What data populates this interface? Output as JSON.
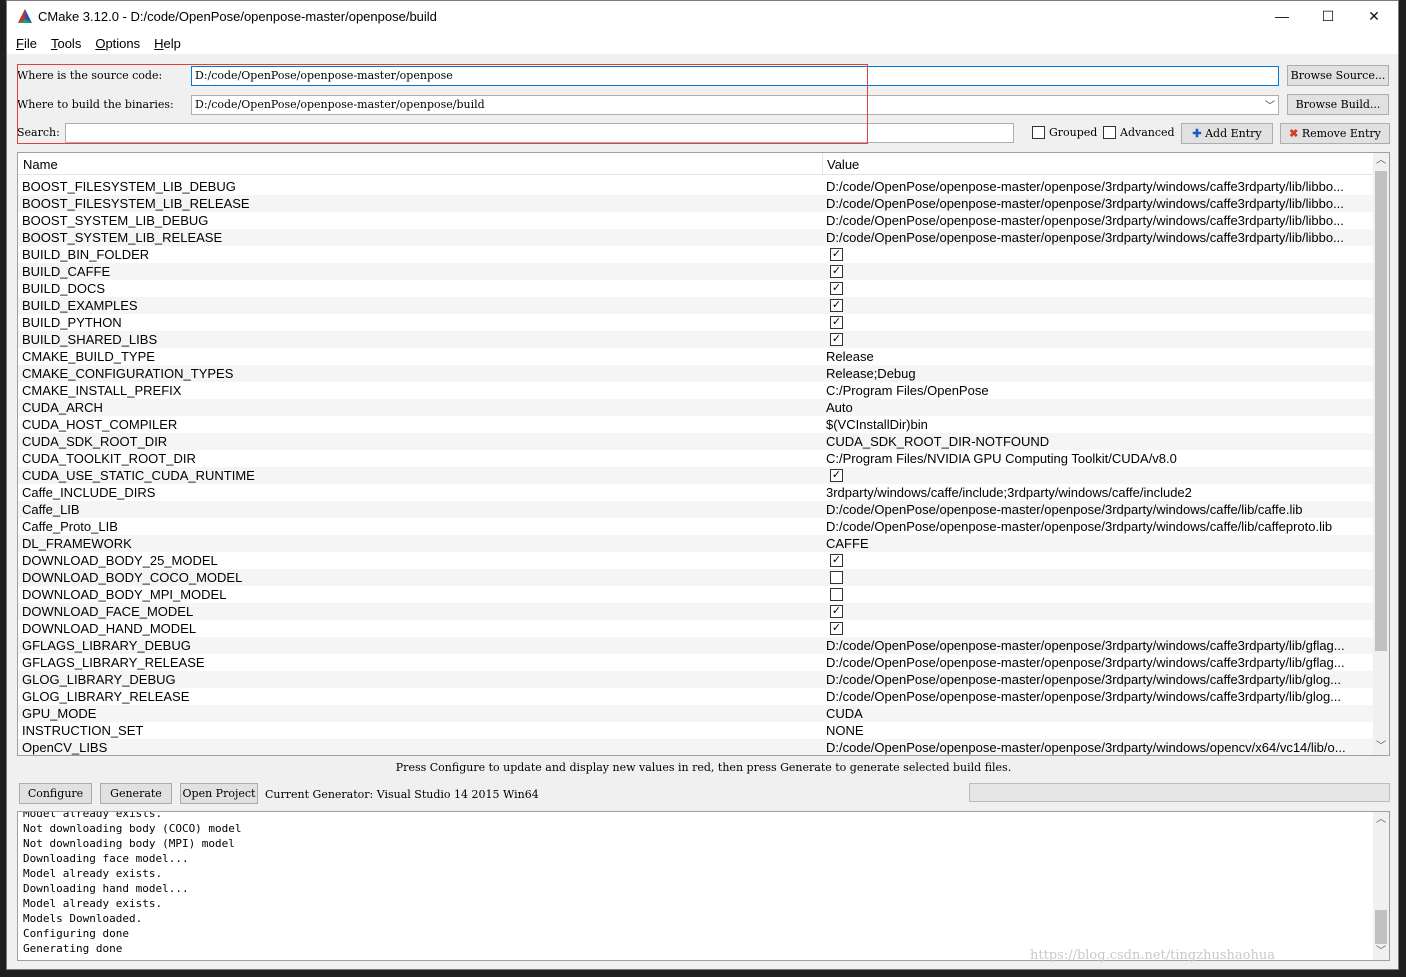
{
  "window": {
    "title": "CMake 3.12.0 - D:/code/OpenPose/openpose-master/openpose/build",
    "minimize_glyph": "—",
    "maximize_glyph": "☐",
    "close_glyph": "✕"
  },
  "menu": [
    {
      "key": "F",
      "rest": "ile"
    },
    {
      "key": "T",
      "rest": "ools"
    },
    {
      "key": "O",
      "rest": "ptions"
    },
    {
      "key": "H",
      "rest": "elp"
    }
  ],
  "paths": {
    "source_label": "Where is the source code:",
    "source_value": "D:/code/OpenPose/openpose-master/openpose",
    "browse_source": "Browse Source...",
    "build_label": "Where to build the binaries:",
    "build_value": "D:/code/OpenPose/openpose-master/openpose/build",
    "browse_build": "Browse Build...",
    "search_label": "Search:",
    "search_value": ""
  },
  "toolbar": {
    "grouped": "Grouped",
    "advanced": "Advanced",
    "add_entry": "Add Entry",
    "remove_entry": "Remove Entry"
  },
  "table": {
    "col_name": "Name",
    "col_value": "Value",
    "rows": [
      {
        "name": "BOOST_FILESYSTEM_LIB_DEBUG",
        "type": "text",
        "value": "D:/code/OpenPose/openpose-master/openpose/3rdparty/windows/caffe3rdparty/lib/libbo..."
      },
      {
        "name": "BOOST_FILESYSTEM_LIB_RELEASE",
        "type": "text",
        "value": "D:/code/OpenPose/openpose-master/openpose/3rdparty/windows/caffe3rdparty/lib/libbo..."
      },
      {
        "name": "BOOST_SYSTEM_LIB_DEBUG",
        "type": "text",
        "value": "D:/code/OpenPose/openpose-master/openpose/3rdparty/windows/caffe3rdparty/lib/libbo..."
      },
      {
        "name": "BOOST_SYSTEM_LIB_RELEASE",
        "type": "text",
        "value": "D:/code/OpenPose/openpose-master/openpose/3rdparty/windows/caffe3rdparty/lib/libbo..."
      },
      {
        "name": "BUILD_BIN_FOLDER",
        "type": "bool",
        "checked": true
      },
      {
        "name": "BUILD_CAFFE",
        "type": "bool",
        "checked": true
      },
      {
        "name": "BUILD_DOCS",
        "type": "bool",
        "checked": true
      },
      {
        "name": "BUILD_EXAMPLES",
        "type": "bool",
        "checked": true
      },
      {
        "name": "BUILD_PYTHON",
        "type": "bool",
        "checked": true
      },
      {
        "name": "BUILD_SHARED_LIBS",
        "type": "bool",
        "checked": true
      },
      {
        "name": "CMAKE_BUILD_TYPE",
        "type": "text",
        "value": "Release"
      },
      {
        "name": "CMAKE_CONFIGURATION_TYPES",
        "type": "text",
        "value": "Release;Debug"
      },
      {
        "name": "CMAKE_INSTALL_PREFIX",
        "type": "text",
        "value": "C:/Program Files/OpenPose"
      },
      {
        "name": "CUDA_ARCH",
        "type": "text",
        "value": "Auto"
      },
      {
        "name": "CUDA_HOST_COMPILER",
        "type": "text",
        "value": "$(VCInstallDir)bin"
      },
      {
        "name": "CUDA_SDK_ROOT_DIR",
        "type": "text",
        "value": "CUDA_SDK_ROOT_DIR-NOTFOUND"
      },
      {
        "name": "CUDA_TOOLKIT_ROOT_DIR",
        "type": "text",
        "value": "C:/Program Files/NVIDIA GPU Computing Toolkit/CUDA/v8.0"
      },
      {
        "name": "CUDA_USE_STATIC_CUDA_RUNTIME",
        "type": "bool",
        "checked": true
      },
      {
        "name": "Caffe_INCLUDE_DIRS",
        "type": "text",
        "value": "3rdparty/windows/caffe/include;3rdparty/windows/caffe/include2"
      },
      {
        "name": "Caffe_LIB",
        "type": "text",
        "value": "D:/code/OpenPose/openpose-master/openpose/3rdparty/windows/caffe/lib/caffe.lib"
      },
      {
        "name": "Caffe_Proto_LIB",
        "type": "text",
        "value": "D:/code/OpenPose/openpose-master/openpose/3rdparty/windows/caffe/lib/caffeproto.lib"
      },
      {
        "name": "DL_FRAMEWORK",
        "type": "text",
        "value": "CAFFE"
      },
      {
        "name": "DOWNLOAD_BODY_25_MODEL",
        "type": "bool",
        "checked": true
      },
      {
        "name": "DOWNLOAD_BODY_COCO_MODEL",
        "type": "bool",
        "checked": false
      },
      {
        "name": "DOWNLOAD_BODY_MPI_MODEL",
        "type": "bool",
        "checked": false
      },
      {
        "name": "DOWNLOAD_FACE_MODEL",
        "type": "bool",
        "checked": true
      },
      {
        "name": "DOWNLOAD_HAND_MODEL",
        "type": "bool",
        "checked": true
      },
      {
        "name": "GFLAGS_LIBRARY_DEBUG",
        "type": "text",
        "value": "D:/code/OpenPose/openpose-master/openpose/3rdparty/windows/caffe3rdparty/lib/gflag..."
      },
      {
        "name": "GFLAGS_LIBRARY_RELEASE",
        "type": "text",
        "value": "D:/code/OpenPose/openpose-master/openpose/3rdparty/windows/caffe3rdparty/lib/gflag..."
      },
      {
        "name": "GLOG_LIBRARY_DEBUG",
        "type": "text",
        "value": "D:/code/OpenPose/openpose-master/openpose/3rdparty/windows/caffe3rdparty/lib/glog..."
      },
      {
        "name": "GLOG_LIBRARY_RELEASE",
        "type": "text",
        "value": "D:/code/OpenPose/openpose-master/openpose/3rdparty/windows/caffe3rdparty/lib/glog..."
      },
      {
        "name": "GPU_MODE",
        "type": "text",
        "value": "CUDA"
      },
      {
        "name": "INSTRUCTION_SET",
        "type": "text",
        "value": "NONE"
      },
      {
        "name": "OpenCV_LIBS",
        "type": "text",
        "value": "D:/code/OpenPose/openpose-master/openpose/3rdparty/windows/opencv/x64/vc14/lib/o..."
      }
    ]
  },
  "hint": "Press Configure to update and display new values in red, then press Generate to generate selected build files.",
  "actions": {
    "configure": "Configure",
    "generate": "Generate",
    "open_project": "Open Project",
    "generator": "Current Generator: Visual Studio 14 2015 Win64"
  },
  "log": [
    "Model already exists.",
    "Not downloading body (COCO) model",
    "Not downloading body (MPI) model",
    "Downloading face model...",
    "Model already exists.",
    "Downloading hand model...",
    "Model already exists.",
    "Models Downloaded.",
    "Configuring done",
    "Generating done"
  ],
  "watermark": "https://blog.csdn.net/tingzhushaohua",
  "colors": {
    "highlight_box": "#e24040",
    "focus_border": "#0078d7"
  }
}
